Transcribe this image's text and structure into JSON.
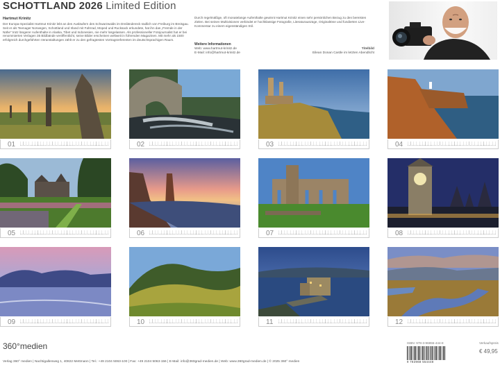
{
  "header": {
    "title_bold": "SCHOTTLAND 2026",
    "title_edition": "Limited Edition"
  },
  "bio": {
    "heading": "Hartmut Krinitz",
    "text": "Der Europa-Spezialist Hartmut Krinitz lebt an den Ausläufern des Schwarzwalds im Dreiländereck südlich von Freiburg im Breisgau. Seit er als Teenager Norwegen, Schottland und Irland mit Fahrrad, Moped und Rucksack erkundete, hat ihn das „Fremde in der Nähe“ trotz längerer Aufenthalte in Alaska, Tibet und Indonesien, nie mehr losgelassen. Als professioneller Fotojournalist hat er bei renommierten Verlagen 35 Bildbände veröffentlicht, seine Bilder erscheinen weltweit in führenden Magazinen. Mit mehr als 1500 erfolgreich durchgeführten Veranstaltungen zählt er zu den gefragtesten Vortragsreferenten im deutschsprachigen Raum."
  },
  "col2": {
    "text": "Durch regelmäßige, oft monatelange Aufenthalte gewinnt Hartmut Krinitz einen sehr persönlichen Bezug zu den bereisten Zielen. Bei seinen Multivisionen verbindet er hochklassige Fotografie, Literaturauszüge, Originaltöne und fundierten Live-Kommentar zu einem eigenständigen Stil.",
    "more_heading": "Weitere Informationen",
    "web": "Web: www.hartmut-krinitz.de",
    "email": "E-Mail: info@hartmut-krinitz.de",
    "titlebild_label": "Titelbild",
    "titlebild_caption": "Eilean Donan Castle im letzten Abendlicht"
  },
  "months": [
    {
      "num": "01",
      "scene": "standing-stones"
    },
    {
      "num": "02",
      "scene": "stone-bridge"
    },
    {
      "num": "03",
      "scene": "castle-ruin-coast"
    },
    {
      "num": "04",
      "scene": "cliffs-lighthouse"
    },
    {
      "num": "05",
      "scene": "garden-castle"
    },
    {
      "num": "06",
      "scene": "sea-stack-sunset"
    },
    {
      "num": "07",
      "scene": "abbey-ruin"
    },
    {
      "num": "08",
      "scene": "clock-tower-night"
    },
    {
      "num": "09",
      "scene": "pink-loch"
    },
    {
      "num": "10",
      "scene": "green-hills"
    },
    {
      "num": "11",
      "scene": "eilean-donan"
    },
    {
      "num": "12",
      "scene": "moor-stream"
    }
  ],
  "footer": {
    "logo_text": "360°medien",
    "address": "Verlag 360° medien | Nachtigallenweg 1, 40822 Mettmann | Tel.: +49 2104 5063-100 | Fax: +49 2104 5063-156 | E-Mail: info@360grad-medien.de | Web: www.360grad-medien.de | © 2025 360° medien",
    "isbn": "ISBN: 978-3-96855-444-8",
    "vk_label": "Verkaufspreis",
    "barcode_digits": "9 783968 554448",
    "price": "€ 49,95"
  },
  "colors": {
    "title": "#3a3a3a",
    "text": "#555555",
    "month_number": "#888888"
  }
}
